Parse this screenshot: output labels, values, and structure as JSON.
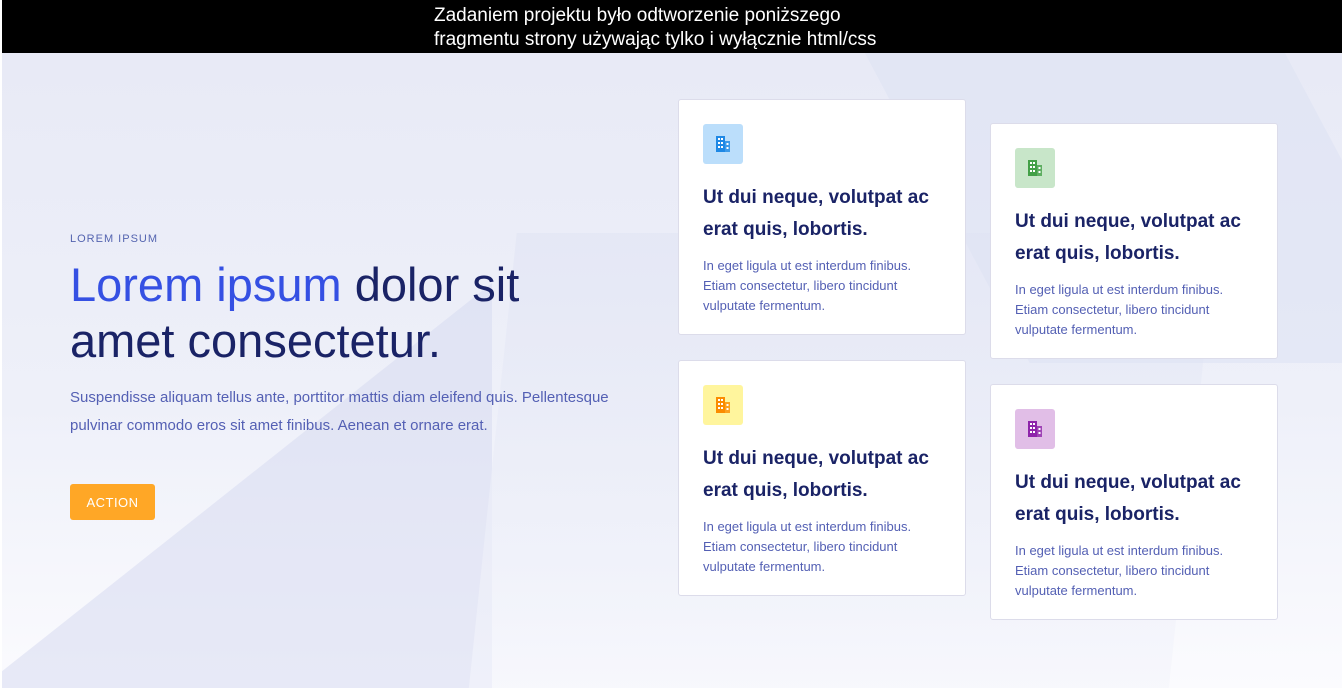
{
  "banner": {
    "line1": "Zadaniem projektu było odtworzenie poniższego",
    "line2": "fragmentu strony używając tylko i wyłącznie html/css"
  },
  "hero": {
    "eyebrow": "LOREM IPSUM",
    "headline_accent": "Lorem ipsum",
    "headline_rest": " dolor sit amet consectetur.",
    "lead": "Suspendisse aliquam tellus ante, porttitor mattis diam eleifend quis. Pellentesque pulvinar commodo eros sit amet finibus. Aenean et ornare erat.",
    "action_label": "ACTION"
  },
  "cards": [
    {
      "icon": "building-icon",
      "icon_color": "#1e88e5",
      "icon_bg": "#bbdefb",
      "title": "Ut dui neque, volutpat ac erat quis, lobortis.",
      "text": "In eget ligula ut est interdum finibus. Etiam consectetur, libero tincidunt vulputate fermentum."
    },
    {
      "icon": "building-icon",
      "icon_color": "#43a047",
      "icon_bg": "#c8e6c9",
      "title": "Ut dui neque, volutpat ac erat quis, lobortis.",
      "text": "In eget ligula ut est interdum finibus. Etiam consectetur, libero tincidunt vulputate fermentum."
    },
    {
      "icon": "building-icon",
      "icon_color": "#fb8c00",
      "icon_bg": "#fff59d",
      "title": "Ut dui neque, volutpat ac erat quis, lobortis.",
      "text": "In eget ligula ut est interdum finibus. Etiam consectetur, libero tincidunt vulputate fermentum."
    },
    {
      "icon": "building-icon",
      "icon_color": "#8e24aa",
      "icon_bg": "#e1bee7",
      "title": "Ut dui neque, volutpat ac erat quis, lobortis.",
      "text": "In eget ligula ut est interdum finibus. Etiam consectetur, libero tincidunt vulputate fermentum."
    }
  ]
}
